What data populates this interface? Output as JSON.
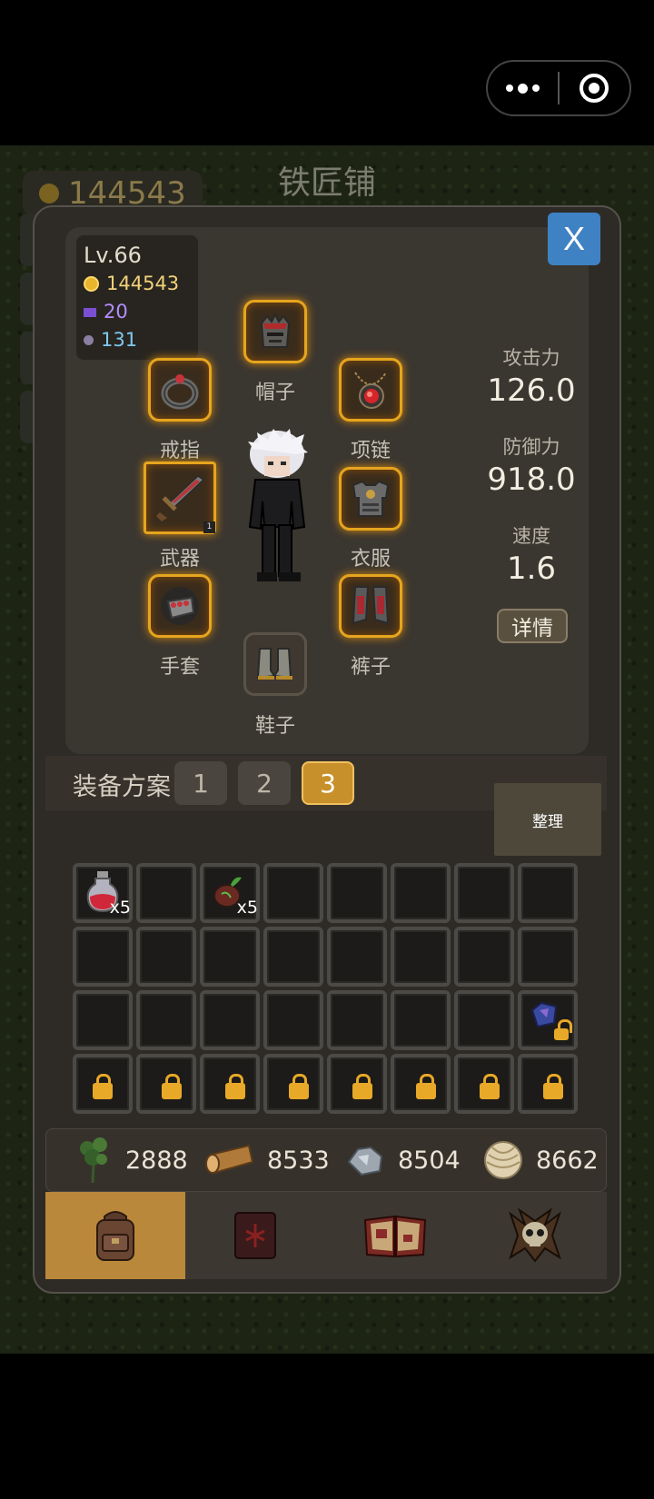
{
  "background": {
    "title": "铁匠铺",
    "gold": "144543"
  },
  "player": {
    "level": "Lv.66",
    "gold": "144543",
    "gems": "20",
    "ore": "131"
  },
  "close_label": "X",
  "equipment": {
    "hat": "帽子",
    "ring": "戒指",
    "necklace": "项链",
    "weapon": "武器",
    "clothes": "衣服",
    "gloves": "手套",
    "pants": "裤子",
    "shoes": "鞋子",
    "weapon_level": "1"
  },
  "attributes": {
    "attack_label": "攻击力",
    "attack": "126.0",
    "defense_label": "防御力",
    "defense": "918.0",
    "speed_label": "速度",
    "speed": "1.6",
    "detail_label": "详情"
  },
  "scheme": {
    "label": "装备方案",
    "options": [
      "1",
      "2",
      "3"
    ],
    "selected": "3"
  },
  "sort_label": "整理",
  "inventory": {
    "potion_qty": "x5",
    "seed_qty": "x5"
  },
  "resources": {
    "herb": "2888",
    "wood": "8533",
    "iron": "8504",
    "thread": "8662"
  },
  "tabs": {
    "selected": "backpack",
    "icons": [
      "backpack-icon",
      "rune-book-icon",
      "spell-book-icon",
      "skull-icon"
    ]
  },
  "colors": {
    "panel": "#2e2b26",
    "accent_gold": "#c8902a",
    "close_blue": "#3f82c3",
    "gem_purple": "#b48cff",
    "ore_blue": "#7fc8f0"
  }
}
